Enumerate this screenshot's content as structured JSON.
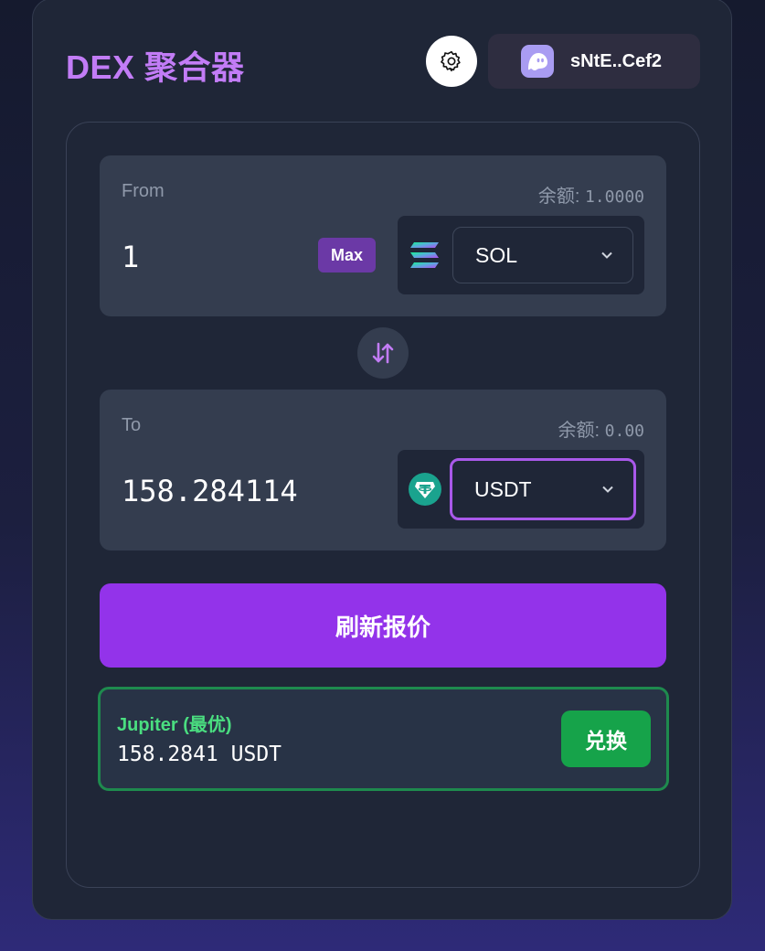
{
  "header": {
    "title": "DEX 聚合器",
    "settings_icon": "gear-icon",
    "wallet": {
      "icon": "phantom-ghost-icon",
      "address": "sNtE..Cef2"
    }
  },
  "from": {
    "label": "From",
    "balance_label": "余额:",
    "balance_value": "1.0000",
    "amount": "1",
    "max_label": "Max",
    "token": {
      "symbol": "SOL",
      "icon": "solana-logo-icon"
    }
  },
  "flip_icon": "swap-arrows-icon",
  "to": {
    "label": "To",
    "balance_label": "余额:",
    "balance_value": "0.00",
    "amount": "158.284114",
    "token": {
      "symbol": "USDT",
      "icon": "tether-logo-icon"
    }
  },
  "quote_button": {
    "label": "刷新报价"
  },
  "route": {
    "name": "Jupiter (最优)",
    "output": "158.2841 USDT",
    "swap_label": "兑换"
  },
  "colors": {
    "accent": "#9333ea",
    "title": "#c27cf6",
    "success": "#16a34a",
    "success_text": "#4ade80"
  }
}
